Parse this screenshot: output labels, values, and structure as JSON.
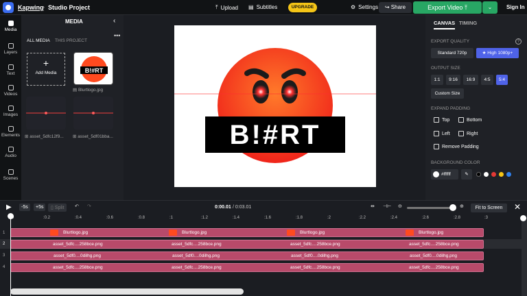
{
  "topbar": {
    "brand": "Kapwing",
    "separator": "›",
    "project": "Studio Project",
    "upload": "Upload",
    "subtitles": "Subtitles",
    "upgrade": "UPGRADE",
    "settings": "Settings",
    "share": "Share",
    "export": "Export Video",
    "sign_in": "Sign In"
  },
  "rail": [
    "Media",
    "Layers",
    "Text",
    "Videos",
    "Images",
    "Elements",
    "Audio",
    "Scenes"
  ],
  "media": {
    "title": "MEDIA",
    "tabs": [
      "ALL MEDIA",
      "THIS PROJECT"
    ],
    "add": "Add Media",
    "items": [
      "Blurtlogo.jpg",
      "asset_5dfc12f9...",
      "asset_5df01bba..."
    ]
  },
  "canvas": {
    "logo_text": "B!#RT"
  },
  "side": {
    "tabs": [
      "CANVAS",
      "TIMING"
    ],
    "export_quality_label": "EXPORT QUALITY",
    "quality": [
      "Standard 720p",
      "★ High 1080p+"
    ],
    "output_size_label": "OUTPUT SIZE",
    "sizes": [
      "1:1",
      "9:16",
      "16:9",
      "4:5",
      "5:4"
    ],
    "custom_size": "Custom Size",
    "padding_label": "EXPAND PADDING",
    "padding": [
      "Top",
      "Bottom",
      "Left",
      "Right",
      "Remove Padding"
    ],
    "bg_label": "BACKGROUND COLOR",
    "bg_value": "#ffffff",
    "swatches": [
      "#000000",
      "#ffffff",
      "#e53935",
      "#f5c517",
      "#2f80ed"
    ]
  },
  "timeline": {
    "back": "-5s",
    "fwd": "+5s",
    "split": "Split",
    "time_current": "0:00.01",
    "time_total": "/ 0:03.01",
    "fit": "Fit to Screen",
    "ticks": [
      "0",
      ":0.2",
      ":0.4",
      ":0.6",
      ":0.8",
      ":1",
      ":1.2",
      ":1.4",
      ":1.6",
      ":1.8",
      ":2",
      ":2.2",
      ":2.4",
      ":2.6",
      ":2.8",
      ":3"
    ],
    "rows": [
      {
        "num": "1",
        "label": "Blurtlogo.jpg"
      },
      {
        "num": "2",
        "label": "asset_5dfc....258bce.png"
      },
      {
        "num": "3",
        "label": "asset_5df0....0dilhg.png"
      },
      {
        "num": "4",
        "label": "asset_5dfc....258bce.png"
      }
    ]
  }
}
